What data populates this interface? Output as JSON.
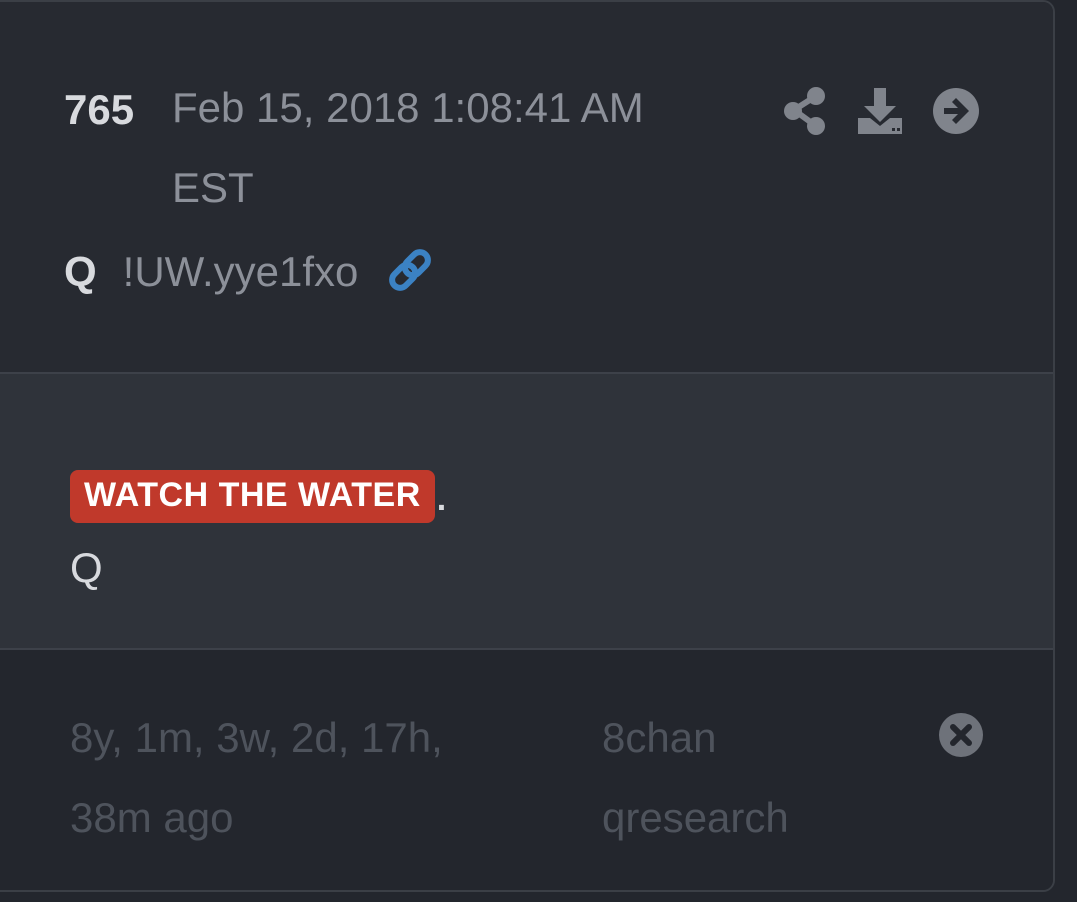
{
  "post": {
    "number": "765",
    "date": "Feb 15, 2018 1:08:41 AM EST",
    "author": "Q",
    "tripcode": "!UW.yye1fxo"
  },
  "actions": {
    "share_icon": "share-icon",
    "download_icon": "download-icon",
    "open_icon": "arrow-right-circle-icon",
    "link_icon": "link-icon"
  },
  "body": {
    "highlight": "WATCH THE WATER",
    "period": ".",
    "signature": "Q"
  },
  "footer": {
    "age": "8y, 1m, 3w, 2d, 17h, 38m ago",
    "source": "8chan qresearch",
    "close_icon": "close-circle-icon"
  },
  "colors": {
    "background": "#23262d",
    "card": "#272a31",
    "body": "#2f333a",
    "highlight": "#c0392b",
    "link": "#3b82c4",
    "muted": "#8c9099",
    "faint": "#4e535c"
  }
}
